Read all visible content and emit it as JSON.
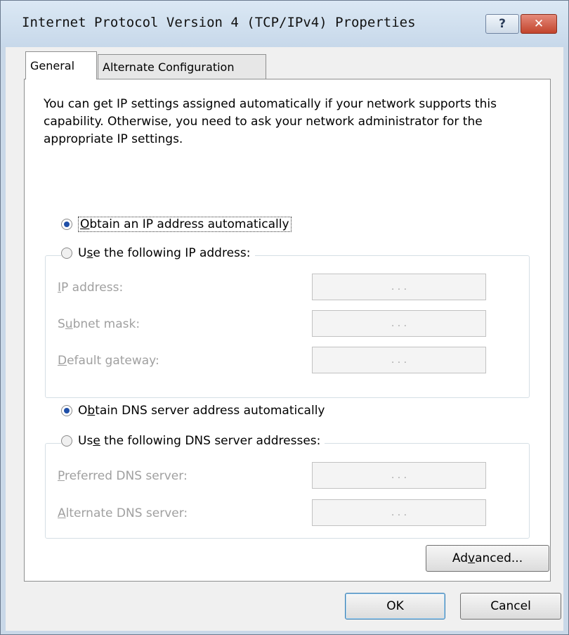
{
  "window": {
    "title": "Internet Protocol Version 4 (TCP/IPv4) Properties",
    "help_label": "?",
    "close_label": "✕"
  },
  "tabs": [
    {
      "label": "General",
      "active": true
    },
    {
      "label": "Alternate Configuration",
      "active": false
    }
  ],
  "intro_text": "You can get IP settings assigned automatically if your network supports this capability. Otherwise, you need to ask your network administrator for the appropriate IP settings.",
  "ip_mode": {
    "auto": {
      "pre": "",
      "key": "O",
      "post": "btain an IP address automatically",
      "checked": true
    },
    "manual": {
      "pre": "U",
      "key": "s",
      "post": "e the following IP address:",
      "checked": false
    }
  },
  "ip_fields": [
    {
      "pre": "",
      "key": "I",
      "post": "P address:",
      "value": ". . ."
    },
    {
      "pre": "S",
      "key": "u",
      "post": "bnet mask:",
      "value": ". . ."
    },
    {
      "pre": "",
      "key": "D",
      "post": "efault gateway:",
      "value": ". . ."
    }
  ],
  "dns_mode": {
    "auto": {
      "pre": "O",
      "key": "b",
      "post": "tain DNS server address automatically",
      "checked": true
    },
    "manual": {
      "pre": "Us",
      "key": "e",
      "post": " the following DNS server addresses:",
      "checked": false
    }
  },
  "dns_fields": [
    {
      "pre": "",
      "key": "P",
      "post": "referred DNS server:",
      "value": ". . ."
    },
    {
      "pre": "",
      "key": "A",
      "post": "lternate DNS server:",
      "value": ". . ."
    }
  ],
  "buttons": {
    "advanced": {
      "pre": "Ad",
      "key": "v",
      "post": "anced..."
    },
    "ok": "OK",
    "cancel": "Cancel"
  },
  "colors": {
    "titlebar": "#c7d8ea",
    "close_button": "#c2442c",
    "radio_selected": "#1f4fa8",
    "disabled_text": "#a0a0a0"
  }
}
